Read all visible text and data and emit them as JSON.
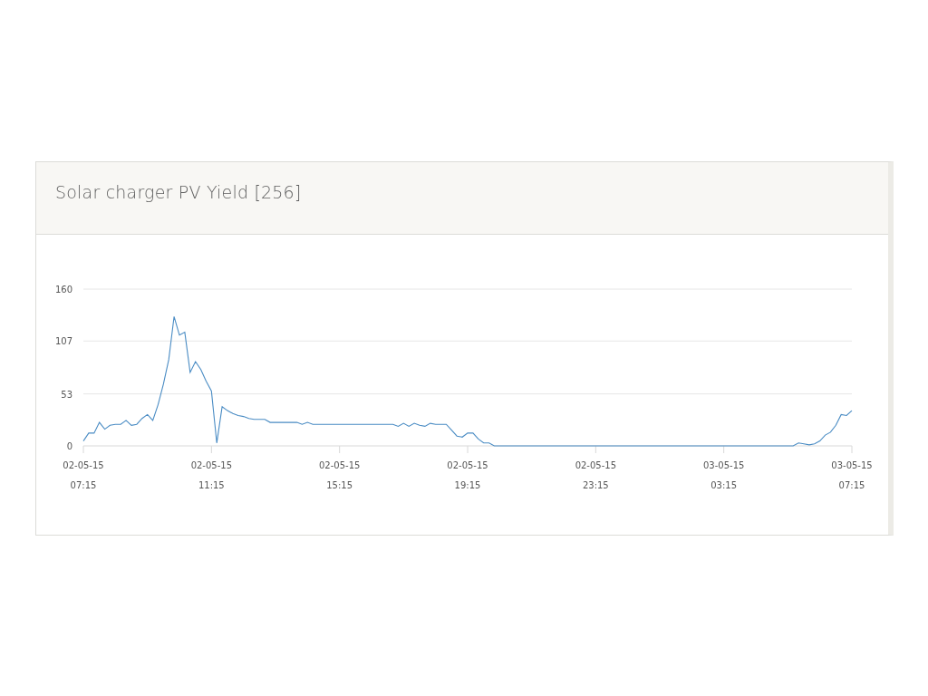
{
  "card": {
    "title": "Solar charger PV Yield [256]",
    "chart_data": {
      "type": "line",
      "categories": [
        "02-05-15 07:15",
        null,
        null,
        null,
        null,
        null,
        null,
        null,
        null,
        null,
        null,
        null,
        null,
        null,
        null,
        null,
        null,
        null,
        null,
        null,
        null,
        null,
        null,
        null,
        "02-05-15 11:15",
        null,
        null,
        null,
        null,
        null,
        null,
        null,
        null,
        null,
        null,
        null,
        null,
        null,
        null,
        null,
        null,
        null,
        null,
        null,
        null,
        null,
        null,
        null,
        "02-05-15 15:15",
        null,
        null,
        null,
        null,
        null,
        null,
        null,
        null,
        null,
        null,
        null,
        null,
        null,
        null,
        null,
        null,
        null,
        null,
        null,
        null,
        null,
        null,
        null,
        "02-05-15 19:15",
        null,
        null,
        null,
        null,
        null,
        null,
        null,
        null,
        null,
        null,
        null,
        null,
        null,
        null,
        null,
        null,
        null,
        null,
        null,
        null,
        null,
        null,
        null,
        "02-05-15 23:15",
        null,
        null,
        null,
        null,
        null,
        null,
        null,
        null,
        null,
        null,
        null,
        null,
        null,
        null,
        null,
        null,
        null,
        null,
        null,
        null,
        null,
        null,
        null,
        "03-05-15 03:15",
        null,
        null,
        null,
        null,
        null,
        null,
        null,
        null,
        null,
        null,
        null,
        null,
        null,
        null,
        null,
        null,
        null,
        null,
        null,
        null,
        null,
        null,
        null,
        "03-05-15 07:15"
      ],
      "series": [
        {
          "color": "#4a8cc4",
          "values": [
            5,
            13,
            13,
            24,
            17,
            21,
            22,
            22,
            26,
            21,
            22,
            28,
            32,
            26,
            42,
            63,
            88,
            132,
            113,
            116,
            75,
            86,
            78,
            66,
            56,
            3,
            40,
            36,
            33,
            31,
            30,
            28,
            27,
            27,
            27,
            24,
            24,
            24,
            24,
            24,
            24,
            22,
            24,
            22,
            22,
            22,
            22,
            22,
            22,
            22,
            22,
            22,
            22,
            22,
            22,
            22,
            22,
            22,
            22,
            20,
            23,
            20,
            23,
            21,
            20,
            23,
            22,
            22,
            22,
            16,
            10,
            9,
            13,
            13,
            7,
            3,
            3,
            0,
            0,
            0,
            0,
            0,
            0,
            0,
            0,
            0,
            0,
            0,
            0,
            0,
            0,
            0,
            0,
            0,
            0,
            0,
            0,
            0,
            0,
            0,
            0,
            0,
            0,
            0,
            0,
            0,
            0,
            0,
            0,
            0,
            0,
            0,
            0,
            0,
            0,
            0,
            0,
            0,
            0,
            0,
            0,
            0,
            0,
            0,
            0,
            0,
            0,
            0,
            0,
            0,
            0,
            0,
            0,
            0,
            3,
            2,
            1,
            2,
            5,
            11,
            14,
            21,
            32,
            31,
            36
          ]
        }
      ],
      "ylim": [
        0,
        160
      ],
      "yticks": [
        0,
        53,
        107,
        160
      ]
    }
  }
}
